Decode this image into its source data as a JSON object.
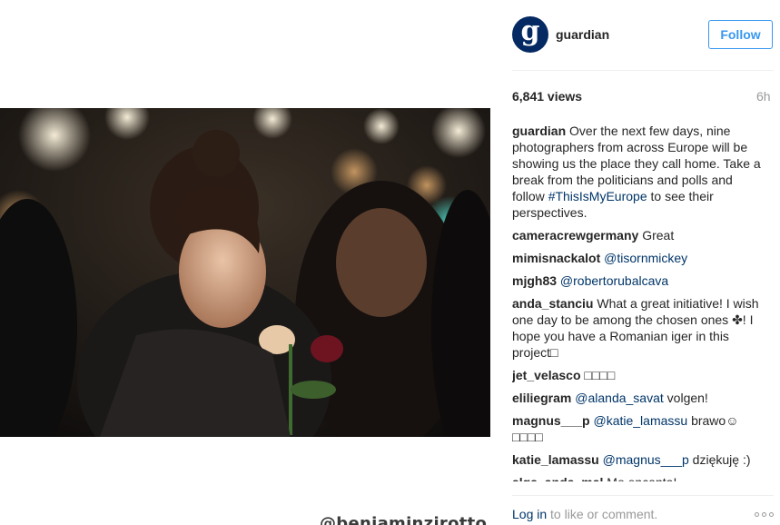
{
  "photo": {
    "watermark": "@benjaminzirotto"
  },
  "header": {
    "avatar_letter": "g",
    "username": "guardian",
    "follow_label": "Follow"
  },
  "meta": {
    "views": "6,841 views",
    "time": "6h"
  },
  "caption": {
    "user": "guardian",
    "text_before": " Over the next few days, nine photographers from across Europe will be showing us the place they call home. Take a break from the politicians and polls and follow ",
    "hashtag": "#ThisIsMyEurope",
    "text_after": " to see their perspectives."
  },
  "comments": [
    {
      "user": "cameracrewgermany",
      "mention": "",
      "text": " Great"
    },
    {
      "user": "mimisnackalot",
      "mention": "@tisornmickey",
      "text": ""
    },
    {
      "user": "mjgh83",
      "mention": "@robertorubalcava",
      "text": ""
    },
    {
      "user": "anda_stanciu",
      "mention": "",
      "text": " What a great initiative! I wish one day to be among the chosen ones ✤! I hope you have a Romanian iger in this project□"
    },
    {
      "user": "jet_velasco",
      "mention": "",
      "text": " □□□□"
    },
    {
      "user": "eliliegram",
      "mention": "@alanda_savat",
      "text": " volgen!"
    },
    {
      "user": "magnus___p",
      "mention": "@katie_lamassu",
      "text": " brawo☺ □□□□"
    },
    {
      "user": "katie_lamassu",
      "mention": "@magnus___p",
      "text": " dziękuję :)"
    },
    {
      "user": "alga_anda_mal",
      "mention": "",
      "text": " Mo encanta!"
    }
  ],
  "footer": {
    "login_link": "Log in",
    "login_rest": " to like or comment."
  },
  "colors": {
    "link": "#003569",
    "follow_blue": "#3897f0",
    "guardian_navy": "#052962"
  },
  "icons": [
    "more-options-icon"
  ]
}
